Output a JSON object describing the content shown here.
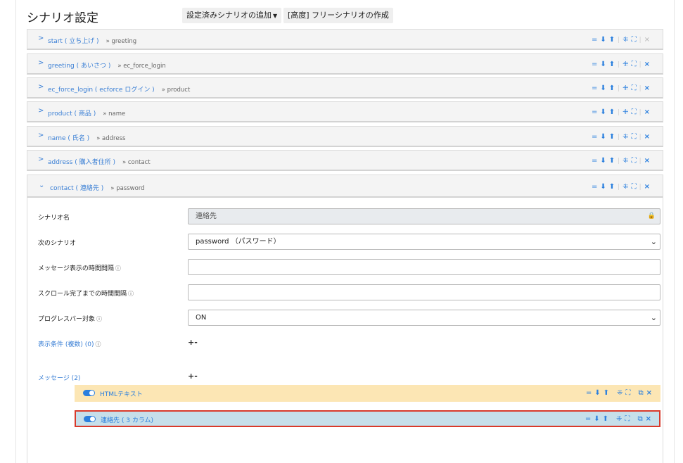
{
  "header": {
    "title": "シナリオ設定",
    "add_preset_label": "設定済みシナリオの追加",
    "create_free_label": "[高度] フリーシナリオの作成"
  },
  "toolbar_icons": [
    "equals-icon",
    "arrow-down-icon",
    "arrow-up-icon",
    "collapse-icon",
    "expand-icon",
    "close-icon"
  ],
  "scenarios": [
    {
      "name": "start ( 立ち上げ )",
      "next": "» greeting",
      "expanded": false,
      "deletable": false
    },
    {
      "name": "greeting ( あいさつ )",
      "next": "» ec_force_login",
      "expanded": false,
      "deletable": true
    },
    {
      "name": "ec_force_login ( ecforce ログイン )",
      "next": "» product",
      "expanded": false,
      "deletable": true
    },
    {
      "name": "product ( 商品 )",
      "next": "» name",
      "expanded": false,
      "deletable": true
    },
    {
      "name": "name ( 氏名 )",
      "next": "» address",
      "expanded": false,
      "deletable": true
    },
    {
      "name": "address ( 購入者住所 )",
      "next": "» contact",
      "expanded": false,
      "deletable": true
    },
    {
      "name": "contact ( 連絡先 )",
      "next": "» password",
      "expanded": true,
      "deletable": true
    }
  ],
  "form": {
    "scenario_name_label": "シナリオ名",
    "scenario_name_value": "連絡先",
    "next_scenario_label": "次のシナリオ",
    "next_scenario_value": "password （パスワード）",
    "message_interval_label": "メッセージ表示の時間間隔",
    "message_interval_value": "",
    "scroll_interval_label": "スクロール完了までの時間間隔",
    "scroll_interval_value": "",
    "progress_label": "プログレスバー対象",
    "progress_value": "ON",
    "conditions_label": "表示条件 (複数) (0)",
    "messages_label": "メッセージ (2)",
    "plus_minus": "+-"
  },
  "messages": [
    {
      "label": "HTMLテキスト",
      "enabled": true,
      "color": "#fce6b4"
    },
    {
      "label": "連絡先 ( 3 カラム)",
      "enabled": true,
      "color": "#c6dfea",
      "highlighted": true
    }
  ],
  "colors": {
    "accent": "#2a7fde",
    "highlight_border": "#d93a2b"
  }
}
